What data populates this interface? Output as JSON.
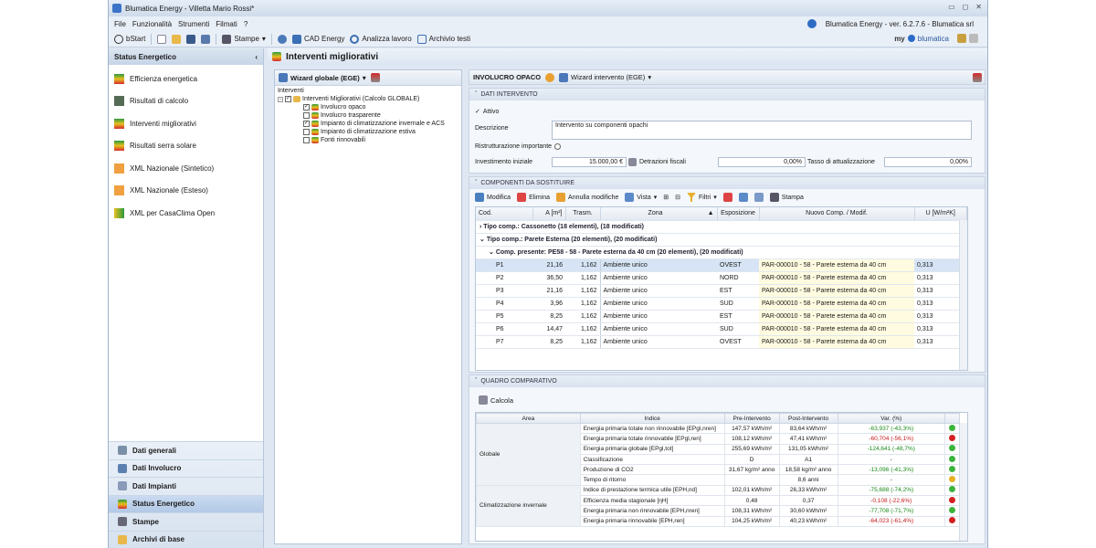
{
  "window": {
    "title": "Blumatica Energy - Villetta Mario Rossi*"
  },
  "menu": [
    "File",
    "Funzionalità",
    "Strumenti",
    "Filmati",
    "?"
  ],
  "version": "Blumatica Energy - ver. 6.2.7.6 - Blumatica srl",
  "toolbar": {
    "bstart": "bStart",
    "stampe": "Stampe",
    "cad": "CAD Energy",
    "analizza": "Analizza lavoro",
    "archivio": "Archivio testi",
    "myblu": "my",
    "brand": "blumatica"
  },
  "sidebar": {
    "title": "Status Energetico",
    "items": [
      "Efficienza energetica",
      "Risultati di calcolo",
      "Interventi migliorativi",
      "Risultati serra solare",
      "XML Nazionale (Sintetico)",
      "XML Nazionale (Esteso)",
      "XML per CasaClima Open"
    ],
    "nav": [
      "Dati generali",
      "Dati Involucro",
      "Dati Impianti",
      "Status Energetico",
      "Stampe",
      "Archivi di base"
    ]
  },
  "main": {
    "title": "Interventi migliorativi"
  },
  "left": {
    "wizard": "Wizard globale (EGE)",
    "tree_label": "Interventi",
    "root": "Interventi Migliorativi (Calcolo GLOBALE)",
    "children": [
      {
        "label": "Involucro opaco",
        "checked": true
      },
      {
        "label": "Involucro trasparente",
        "checked": false
      },
      {
        "label": "Impianto di climatizzazione invernale e ACS",
        "checked": true
      },
      {
        "label": "Impianto di climatizzazione estiva",
        "checked": false
      },
      {
        "label": "Fonti rinnovabili",
        "checked": false
      }
    ]
  },
  "right": {
    "section": "INVOLUCRO OPACO",
    "wizard": "Wizard intervento (EGE)",
    "dati": {
      "head": "DATI INTERVENTO",
      "attivo": "Attivo",
      "descr_label": "Descrizione",
      "descr": "Intervento su componenti opachi",
      "ristr": "Ristrutturazione importante",
      "inv_label": "Investimento iniziale",
      "inv": "15.000,00 €",
      "detr_label": "Detrazioni fiscali",
      "detr": "0,00%",
      "tasso_label": "Tasso di attualizzazione",
      "tasso": "0,00%"
    },
    "comp": {
      "head": "COMPONENTI DA SOSTITUIRE",
      "tools": [
        "Modifica",
        "Elimina",
        "Annulla modifiche",
        "Vista",
        "Filtri",
        "Stampa"
      ],
      "cols": [
        "Cod.",
        "A [m²]",
        "Trasm.",
        "Zona",
        "Esposizione",
        "Nuovo Comp. / Modif.",
        "U [W/m²K]"
      ],
      "groups": [
        "Tipo comp.: Cassonetto (18 elementi), (18 modificati)",
        "Tipo comp.: Parete Esterna (20 elementi), (20 modificati)",
        "Comp. presente: PE58 - 58 - Parete esterna da 40 cm (20 elementi), (20 modificati)"
      ],
      "rows": [
        {
          "cod": "P1",
          "a": "21,16",
          "t": "1,162",
          "z": "Ambiente unico",
          "e": "OVEST",
          "n": "PAR-000010 - 58 - Parete esterna da 40 cm",
          "u": "0,313"
        },
        {
          "cod": "P2",
          "a": "36,50",
          "t": "1,162",
          "z": "Ambiente unico",
          "e": "NORD",
          "n": "PAR-000010 - 58 - Parete esterna da 40 cm",
          "u": "0,313"
        },
        {
          "cod": "P3",
          "a": "21,16",
          "t": "1,162",
          "z": "Ambiente unico",
          "e": "EST",
          "n": "PAR-000010 - 58 - Parete esterna da 40 cm",
          "u": "0,313"
        },
        {
          "cod": "P4",
          "a": "3,96",
          "t": "1,162",
          "z": "Ambiente unico",
          "e": "SUD",
          "n": "PAR-000010 - 58 - Parete esterna da 40 cm",
          "u": "0,313"
        },
        {
          "cod": "P5",
          "a": "8,25",
          "t": "1,162",
          "z": "Ambiente unico",
          "e": "EST",
          "n": "PAR-000010 - 58 - Parete esterna da 40 cm",
          "u": "0,313"
        },
        {
          "cod": "P6",
          "a": "14,47",
          "t": "1,162",
          "z": "Ambiente unico",
          "e": "SUD",
          "n": "PAR-000010 - 58 - Parete esterna da 40 cm",
          "u": "0,313"
        },
        {
          "cod": "P7",
          "a": "8,25",
          "t": "1,162",
          "z": "Ambiente unico",
          "e": "OVEST",
          "n": "PAR-000010 - 58 - Parete esterna da 40 cm",
          "u": "0,313"
        }
      ]
    },
    "quadro": {
      "head": "QUADRO COMPARATIVO",
      "calcola": "Calcola",
      "cols": [
        "Area",
        "Indice",
        "Pre-Intervento",
        "Post-Intervento",
        "Var. (%)"
      ],
      "areas": [
        {
          "name": "Globale",
          "span": 6
        },
        {
          "name": "Climatizzazione invernale",
          "span": 5
        }
      ],
      "rows": [
        {
          "i": "Energia primaria totale non rinnovabile [EPgl,nren]",
          "pre": "147,57 kWh/m²",
          "post": "83,64 kWh/m²",
          "v": "-63,937 (-43,3%)",
          "vc": "#1a8a1a",
          "dot": "#3cb43c"
        },
        {
          "i": "Energia primaria totale rinnovabile [EPgl,ren]",
          "pre": "108,12 kWh/m²",
          "post": "47,41 kWh/m²",
          "v": "-60,704 (-56,1%)",
          "vc": "#c41a1a",
          "dot": "#d42020"
        },
        {
          "i": "Energia primaria globale [EPgl,tot]",
          "pre": "255,69 kWh/m²",
          "post": "131,05 kWh/m²",
          "v": "-124,641 (-48,7%)",
          "vc": "#1a8a1a",
          "dot": "#3cb43c"
        },
        {
          "i": "Classificazione",
          "pre": "D",
          "post": "A1",
          "v": "-",
          "vc": "#222",
          "dot": "#3cb43c"
        },
        {
          "i": "Produzione di CO2",
          "pre": "31,67 kg/m² anno",
          "post": "18,58 kg/m² anno",
          "v": "-13,096 (-41,3%)",
          "vc": "#1a8a1a",
          "dot": "#3cb43c"
        },
        {
          "i": "Tempo di ritorno",
          "pre": "",
          "post": "8,6 anni",
          "v": "-",
          "vc": "#222",
          "dot": "#e6b020"
        },
        {
          "i": "Indice di prestazione termica utile [EPH,nd]",
          "pre": "102,01 kWh/m²",
          "post": "26,33 kWh/m²",
          "v": "-75,688 (-74,2%)",
          "vc": "#1a8a1a",
          "dot": "#3cb43c"
        },
        {
          "i": "Efficienza media stagionale [ηH]",
          "pre": "0,48",
          "post": "0,37",
          "v": "-0,108 (-22,6%)",
          "vc": "#c41a1a",
          "dot": "#d42020"
        },
        {
          "i": "Energia primaria non rinnovabile [EPH,nren]",
          "pre": "108,31 kWh/m²",
          "post": "30,60 kWh/m²",
          "v": "-77,708 (-71,7%)",
          "vc": "#1a8a1a",
          "dot": "#3cb43c"
        },
        {
          "i": "Energia primaria rinnovabile [EPH,ren]",
          "pre": "104,25 kWh/m²",
          "post": "40,23 kWh/m²",
          "v": "-64,023 (-61,4%)",
          "vc": "#c41a1a",
          "dot": "#d42020"
        }
      ]
    }
  }
}
